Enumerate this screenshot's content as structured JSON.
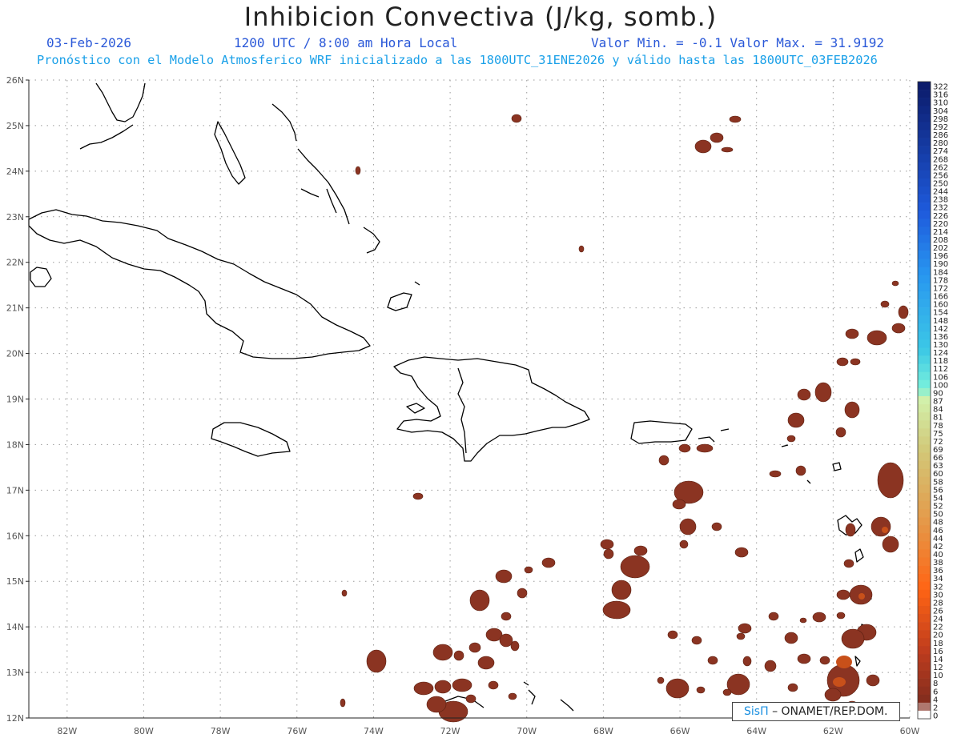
{
  "header": {
    "title": "Inhibicion Convectiva (J/kg, somb.)",
    "date": "03-Feb-2026",
    "time": "1200 UTC / 8:00 am Hora Local",
    "value_range": "Valor Min. = -0.1  Valor Max. = 31.9192",
    "forecast_note": "Pronóstico con el Modelo Atmosferico WRF inicializado a las 1800UTC_31ENE2026 y válido hasta las  1800UTC_03FEB2026"
  },
  "map": {
    "lon_labels": [
      "82W",
      "80W",
      "78W",
      "76W",
      "74W",
      "72W",
      "70W",
      "68W",
      "66W",
      "64W",
      "62W",
      "60W"
    ],
    "lat_labels": [
      "26N",
      "25N",
      "24N",
      "23N",
      "22N",
      "21N",
      "20N",
      "19N",
      "18N",
      "17N",
      "16N",
      "15N",
      "14N",
      "13N",
      "12N"
    ],
    "extent": {
      "lon_min": -83,
      "lon_max": -60,
      "lat_min": 12,
      "lat_max": 26
    },
    "shading_color": "#8b3422",
    "shading_highlight": "#c8501a",
    "coastline_color": "#000000",
    "grid": "dotted"
  },
  "colorbar": {
    "labels": [
      "322",
      "316",
      "310",
      "304",
      "298",
      "292",
      "286",
      "280",
      "274",
      "268",
      "262",
      "256",
      "250",
      "244",
      "238",
      "232",
      "226",
      "220",
      "214",
      "208",
      "202",
      "196",
      "190",
      "184",
      "178",
      "172",
      "166",
      "160",
      "154",
      "148",
      "142",
      "136",
      "130",
      "124",
      "118",
      "112",
      "106",
      "100",
      "90",
      "87",
      "84",
      "81",
      "78",
      "75",
      "72",
      "69",
      "66",
      "63",
      "60",
      "58",
      "56",
      "54",
      "52",
      "50",
      "48",
      "46",
      "44",
      "42",
      "40",
      "38",
      "36",
      "34",
      "32",
      "30",
      "28",
      "26",
      "24",
      "22",
      "20",
      "18",
      "16",
      "14",
      "12",
      "10",
      "8",
      "6",
      "4",
      "2",
      "0"
    ]
  },
  "logo": {
    "symbol": "SisΠ",
    "text": "– ONAMET/REP.DOM."
  }
}
